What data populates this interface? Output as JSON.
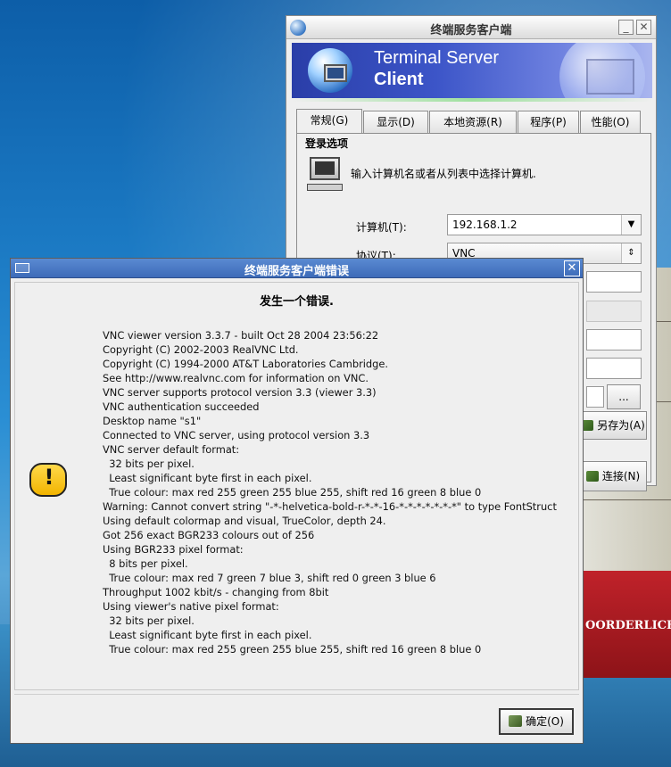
{
  "ts_window": {
    "title": "终端服务客户端",
    "minimize_glyph": "_",
    "close_glyph": "✕",
    "banner_line1": "Terminal Server",
    "banner_line2": "Client",
    "tabs": [
      {
        "label": "常规(G)",
        "active": true
      },
      {
        "label": "显示(D)",
        "active": false
      },
      {
        "label": "本地资源(R)",
        "active": false
      },
      {
        "label": "程序(P)",
        "active": false
      },
      {
        "label": "性能(O)",
        "active": false
      }
    ],
    "section_title": "登录选项",
    "hint": "输入计算机名或者从列表中选择计算机.",
    "computer_label": "计算机(T):",
    "computer_value": "192.168.1.2",
    "protocol_label": "协议(T):",
    "protocol_value": "VNC",
    "browse_label": "...",
    "save_as_label": "另存为(A)",
    "connect_label": "连接(N)"
  },
  "error_dialog": {
    "title": "终端服务客户端错误",
    "close_glyph": "✕",
    "heading": "发生一个错误.",
    "icon": "warning-icon",
    "log_lines": [
      "VNC viewer version 3.3.7 - built Oct 28 2004 23:56:22",
      "Copyright (C) 2002-2003 RealVNC Ltd.",
      "Copyright (C) 1994-2000 AT&T Laboratories Cambridge.",
      "See http://www.realvnc.com for information on VNC.",
      "VNC server supports protocol version 3.3 (viewer 3.3)",
      "VNC authentication succeeded",
      "Desktop name \"s1\"",
      "Connected to VNC server, using protocol version 3.3",
      "VNC server default format:",
      "  32 bits per pixel.",
      "  Least significant byte first in each pixel.",
      "  True colour: max red 255 green 255 blue 255, shift red 16 green 8 blue 0",
      "Warning: Cannot convert string \"-*-helvetica-bold-r-*-*-16-*-*-*-*-*-*-*\" to type FontStruct",
      "Using default colormap and visual, TrueColor, depth 24.",
      "Got 256 exact BGR233 colours out of 256",
      "Using BGR233 pixel format:",
      "  8 bits per pixel.",
      "  True colour: max red 7 green 7 blue 3, shift red 0 green 3 blue 6",
      "Throughput 1002 kbit/s - changing from 8bit",
      "Using viewer's native pixel format:",
      "  32 bits per pixel.",
      "  Least significant byte first in each pixel.",
      "  True colour: max red 255 green 255 blue 255, shift red 16 green 8 blue 0"
    ],
    "ok_label": "确定(O)"
  },
  "background": {
    "ship_name": "OORDERLICHT"
  }
}
